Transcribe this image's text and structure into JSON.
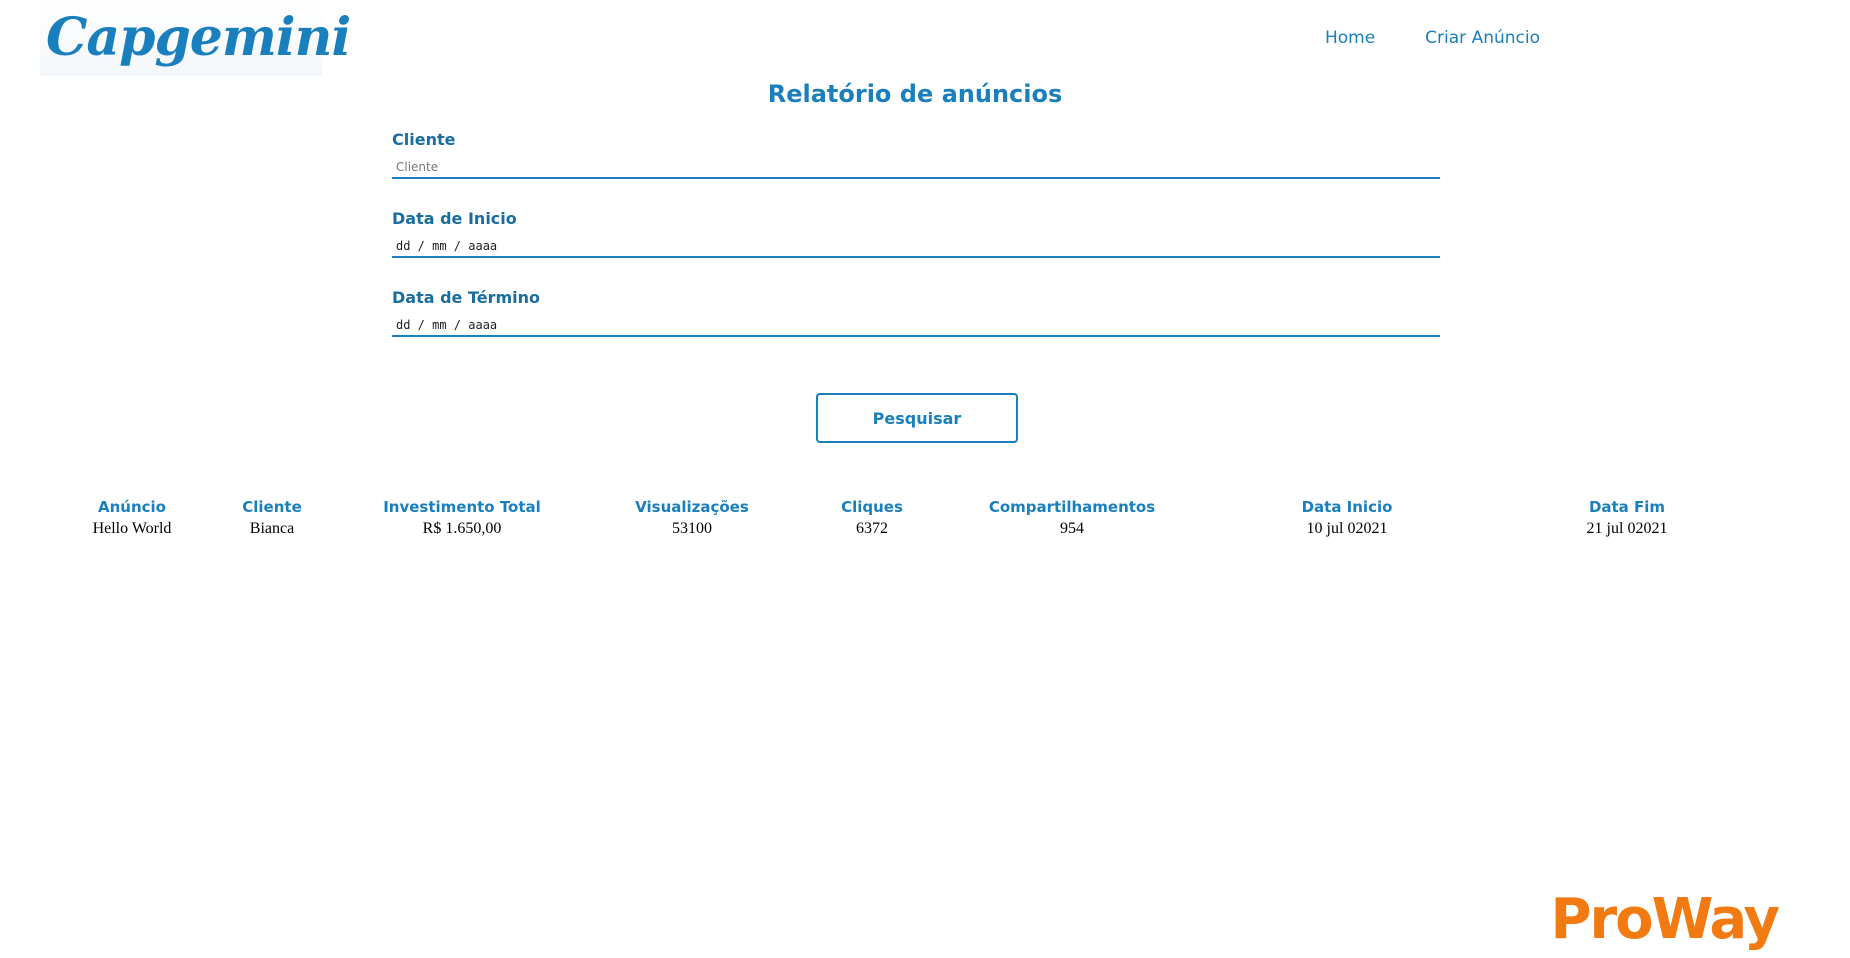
{
  "header": {
    "logo_text": "Capgemini",
    "nav": {
      "home": "Home",
      "create_ad": "Criar Anúncio"
    }
  },
  "page_title": "Relatório de anúncios",
  "form": {
    "client_label": "Cliente",
    "client_placeholder": "Cliente",
    "start_label": "Data de Inicio",
    "start_placeholder": "dd / mm / aaaa",
    "end_label": "Data de Término",
    "end_placeholder": "dd / mm / aaaa",
    "search_button": "Pesquisar"
  },
  "table": {
    "headers": [
      "Anúncio",
      "Cliente",
      "Investimento Total",
      "Visualizações",
      "Cliques",
      "Compartilhamentos",
      "Data Inicio",
      "Data Fim"
    ],
    "rows": [
      [
        "Hello World",
        "Bianca",
        "R$ 1.650,00",
        "53100",
        "6372",
        "954",
        "10 jul 02021",
        "21 jul 02021"
      ]
    ]
  },
  "footer": {
    "logo_text": "ProWay"
  },
  "colors": {
    "accent": "#1a7fbd",
    "footer_logo": "#f27a10"
  }
}
